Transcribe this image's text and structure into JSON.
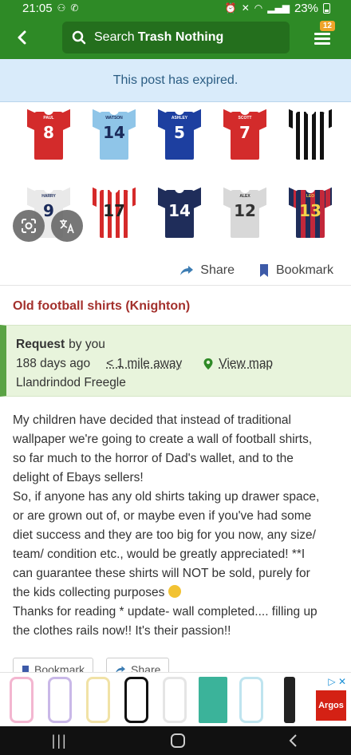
{
  "status_bar": {
    "time": "21:05",
    "battery": "23%"
  },
  "app_bar": {
    "search_prefix": "Search",
    "search_brand": "Trash Nothing",
    "notification_count": "12"
  },
  "banner": {
    "text": "This post has expired."
  },
  "photo": {
    "shirts_row1": [
      {
        "name": "PAUL",
        "number": "8",
        "color": "#d32b2b",
        "text": "#ffffff"
      },
      {
        "name": "WATSON",
        "number": "14",
        "color": "#8fc5e8",
        "text": "#1a2a5a"
      },
      {
        "name": "ASHLEY",
        "number": "5",
        "color": "#1d3fa0",
        "text": "#ffffff"
      },
      {
        "name": "SCOTT",
        "number": "7",
        "color": "#d32b2b",
        "text": "#ffffff"
      },
      {
        "name": "",
        "number": "",
        "color": "stripes",
        "text": "#ffffff"
      }
    ],
    "shirts_row2": [
      {
        "name": "HARRY",
        "number": "9",
        "color": "#e9e9e9",
        "text": "#1a2a5a"
      },
      {
        "name": "",
        "number": "17",
        "color": "redstripes",
        "text": "#222222"
      },
      {
        "name": "",
        "number": "14",
        "color": "#1f2d5a",
        "text": "#ffffff"
      },
      {
        "name": "ALEX",
        "number": "12",
        "color": "#d8d8d8",
        "text": "#333333"
      },
      {
        "name": "LEO",
        "number": "13",
        "color": "navyred",
        "text": "#f3d34a"
      }
    ]
  },
  "actions": {
    "share": "Share",
    "bookmark": "Bookmark"
  },
  "post": {
    "title": "Old football shirts (Knighton)",
    "request_label": "Request",
    "by": "by you",
    "age": "188 days ago",
    "distance": "< 1 mile away",
    "map": "View map",
    "group": "Llandrindod Freegle",
    "description": [
      "My children have decided that instead of traditional wallpaper we're going to create a wall of football shirts, so far much to the horror of Dad's wallet, and to the delight of Ebays sellers!",
      "So, if anyone has any old shirts taking up drawer space, or are grown out of, or maybe even if you've had some diet success and they are too big for you now, any size/ team/ condition etc., would be greatly appreciated! **I can guarantee these shirts will NOT be sold, purely for the kids collecting purposes",
      "Thanks for reading * update- wall completed.... filling up the clothes rails now!! It's their passion!!"
    ]
  },
  "lower_actions": {
    "bookmark": "Bookmark",
    "share": "Share"
  },
  "ad": {
    "brand": "Argos"
  },
  "colors": {
    "primary_green": "#2e8a26",
    "title_red": "#a3302c",
    "info_bg": "#e8f4dc"
  }
}
